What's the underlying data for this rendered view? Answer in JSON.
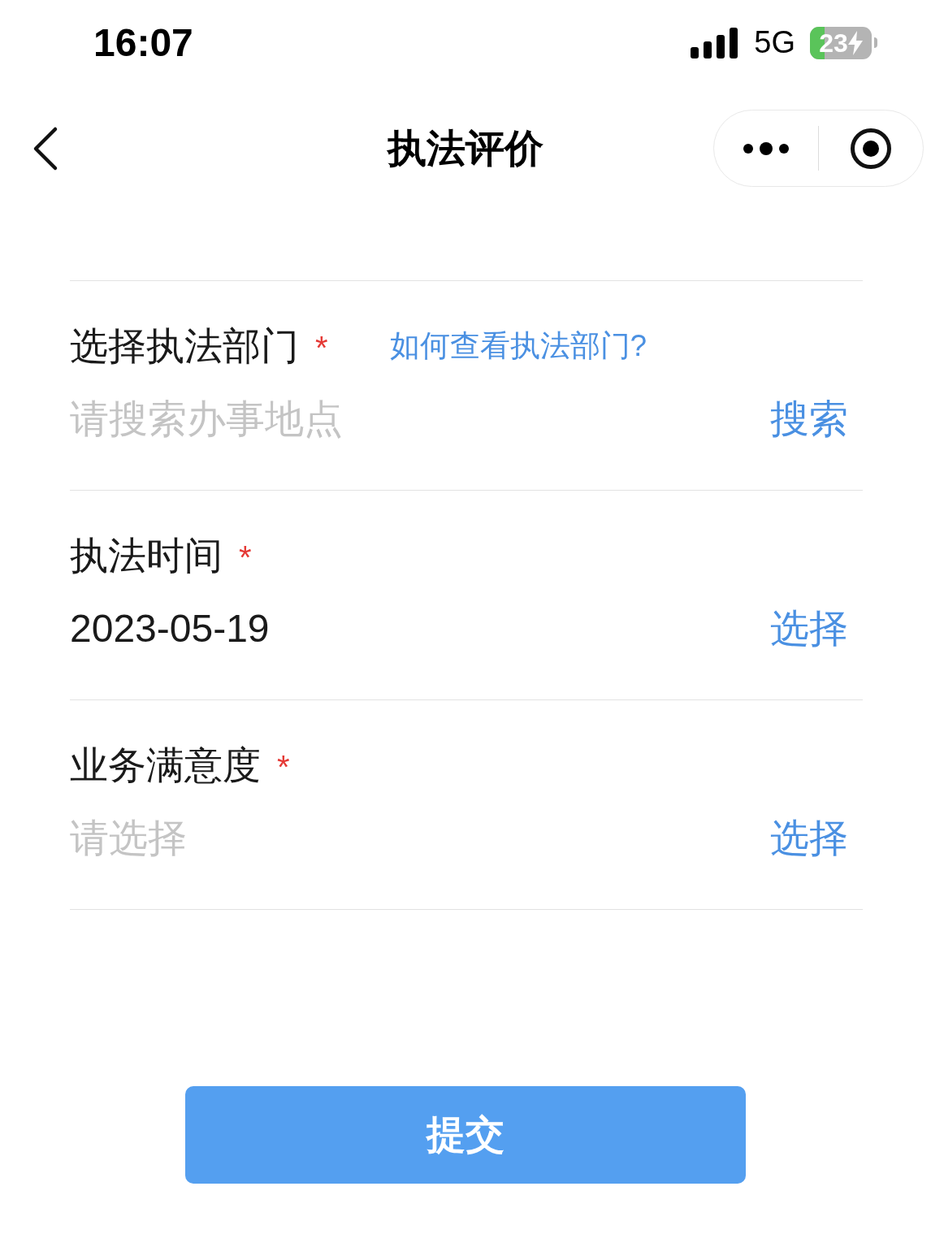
{
  "status_bar": {
    "time": "16:07",
    "network": "5G",
    "battery": "23",
    "charging": true
  },
  "nav_bar": {
    "title": "执法评价"
  },
  "form": {
    "fields": [
      {
        "label": "选择执法部门",
        "required_mark": "*",
        "help_link": "如何查看执法部门?",
        "placeholder": "请搜索办事地点",
        "action": "搜索"
      },
      {
        "label": "执法时间",
        "required_mark": "*",
        "value": "2023-05-19",
        "action": "选择"
      },
      {
        "label": "业务满意度",
        "required_mark": "*",
        "placeholder": "请选择",
        "action": "选择"
      }
    ]
  },
  "submit_button": "提交"
}
